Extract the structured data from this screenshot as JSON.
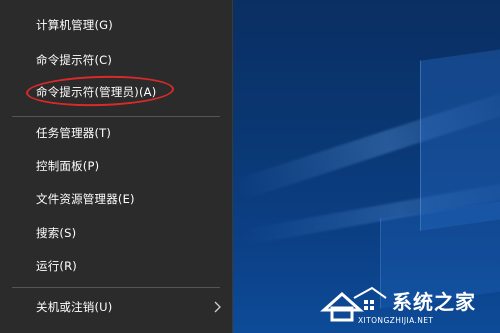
{
  "menu": {
    "items": [
      {
        "label": "计算机管理(G)"
      },
      {
        "label": "命令提示符(C)"
      },
      {
        "label": "命令提示符(管理员)(A)"
      },
      {
        "label": "任务管理器(T)"
      },
      {
        "label": "控制面板(P)"
      },
      {
        "label": "文件资源管理器(E)"
      },
      {
        "label": "搜索(S)"
      },
      {
        "label": "运行(R)"
      },
      {
        "label": "关机或注销(U)",
        "icon": "chevron-right-icon"
      }
    ]
  },
  "watermark": {
    "brand": "系统之家",
    "domain": "XITONGZHIJIA.NET",
    "icon": "house-logo-icon"
  },
  "colors": {
    "menu_bg": "#2b2b2b",
    "highlight": "#d92a2a",
    "desktop": "#0b3f84"
  }
}
